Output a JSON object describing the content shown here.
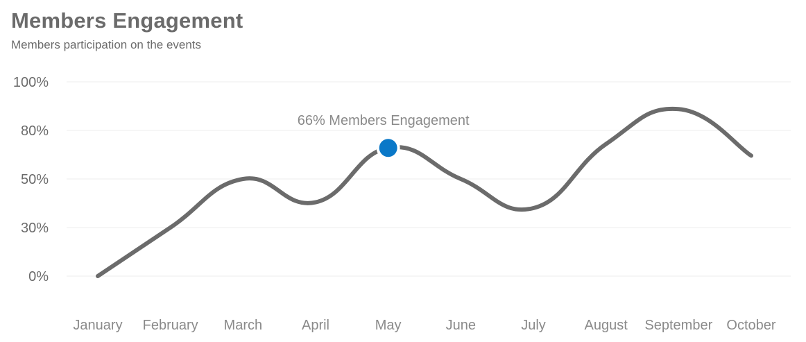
{
  "title": "Members Engagement",
  "subtitle": "Members participation on the events",
  "chart_data": {
    "type": "line",
    "title": "Members Engagement",
    "subtitle": "Members participation on the events",
    "xlabel": "",
    "ylabel": "",
    "categories": [
      "January",
      "February",
      "March",
      "April",
      "May",
      "June",
      "July",
      "August",
      "September",
      "October"
    ],
    "y_tick_labels": [
      "100%",
      "80%",
      "50%",
      "30%",
      "0%"
    ],
    "ylim": [
      0,
      100
    ],
    "grid": true,
    "highlight": {
      "category": "May",
      "label": "66% Members Engagement",
      "color": "#0a78c8"
    },
    "series": [
      {
        "values": [
          0,
          25,
          50,
          38,
          66,
          50,
          35,
          68,
          86,
          62
        ],
        "color": "#6b6b6b"
      }
    ]
  }
}
